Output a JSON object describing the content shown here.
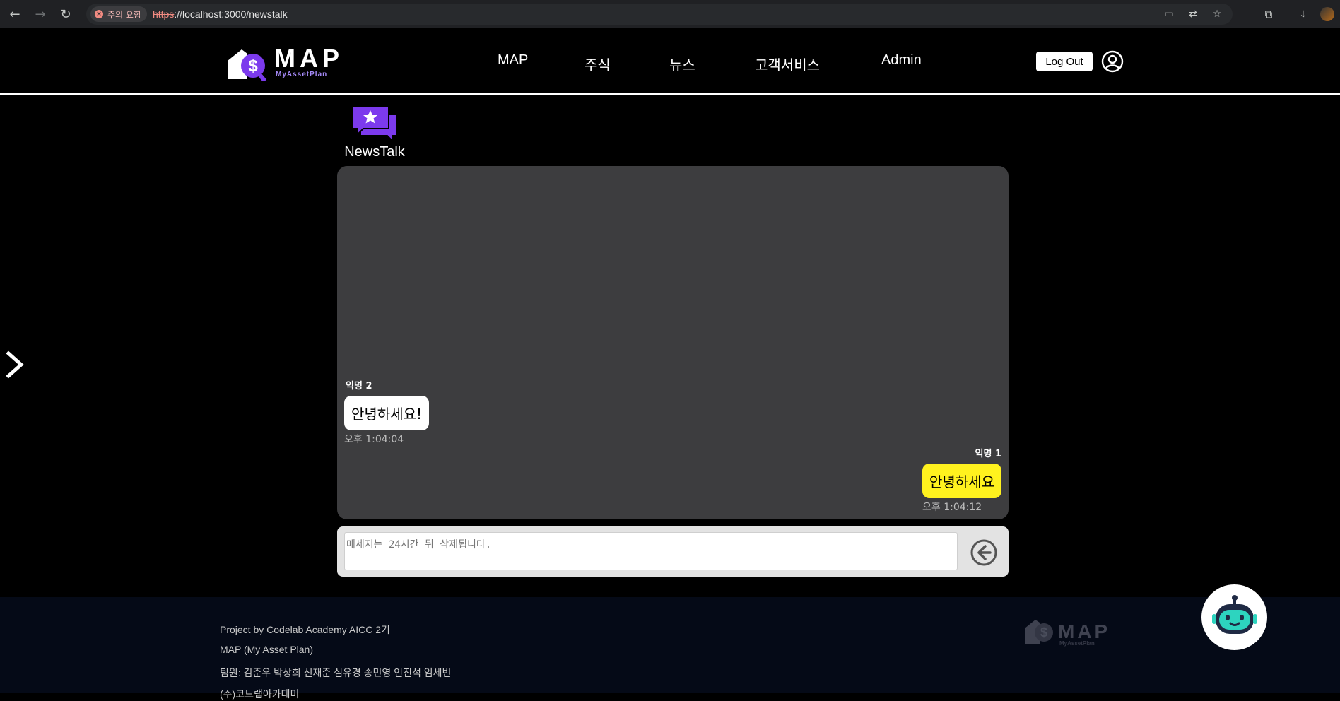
{
  "browser": {
    "security_label": "주의 요함",
    "url_scheme": "https",
    "url_rest": "://localhost:3000/newstalk"
  },
  "header": {
    "logo_word": "MAP",
    "logo_sub": "MyAssetPlan",
    "nav": [
      "MAP",
      "주식",
      "뉴스",
      "고객서비스",
      "Admin"
    ],
    "logout_label": "Log Out"
  },
  "page": {
    "title": "NewsTalk"
  },
  "chat": {
    "messages": [
      {
        "sender": "익명 2",
        "text": "안녕하세요!",
        "time": "오후 1:04:04",
        "side": "left",
        "color": "#ffffff"
      },
      {
        "sender": "익명 1",
        "text": "안녕하세요",
        "time": "오후 1:04:12",
        "side": "right",
        "color": "#fff21e"
      }
    ],
    "input_placeholder": "메세지는 24시간 뒤 삭제됩니다."
  },
  "footer": {
    "lines": [
      "Project by Codelab Academy AICC 2기",
      "MAP (My Asset Plan)",
      "팀원: 김준우 박상희 신재준 심유경 송민영 인진석 임세빈",
      "(주)코드랩아카데미"
    ]
  },
  "colors": {
    "accent_purple": "#7c3aed",
    "panel_bg": "#3d3d3f",
    "my_bubble": "#fff21e"
  }
}
